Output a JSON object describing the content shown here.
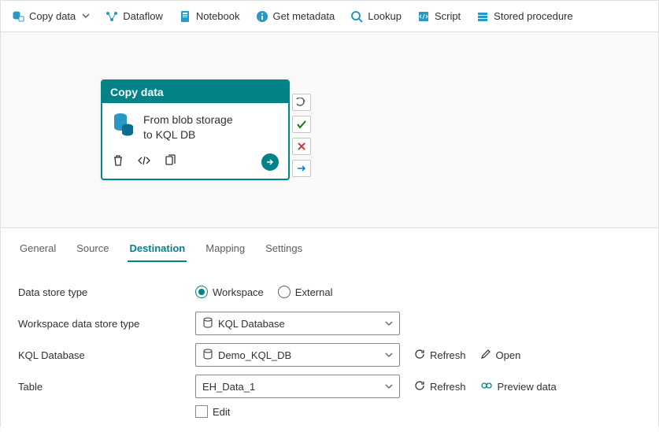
{
  "toolbar": {
    "copy_data": "Copy data",
    "dataflow": "Dataflow",
    "notebook": "Notebook",
    "get_metadata": "Get metadata",
    "lookup": "Lookup",
    "script": "Script",
    "stored_procedure": "Stored procedure"
  },
  "activity": {
    "title": "Copy data",
    "line1": "From blob storage",
    "line2": "to KQL DB"
  },
  "tabs": {
    "general": "General",
    "source": "Source",
    "destination": "Destination",
    "mapping": "Mapping",
    "settings": "Settings"
  },
  "form": {
    "datastoretype_label": "Data store type",
    "workspace_opt": "Workspace",
    "external_opt": "External",
    "wds_label": "Workspace data store type",
    "wds_value": "KQL Database",
    "kqldb_label": "KQL Database",
    "kqldb_value": "Demo_KQL_DB",
    "refresh": "Refresh",
    "open": "Open",
    "table_label": "Table",
    "table_value": "EH_Data_1",
    "preview": "Preview data",
    "edit": "Edit"
  },
  "colors": {
    "accent": "#038387"
  }
}
